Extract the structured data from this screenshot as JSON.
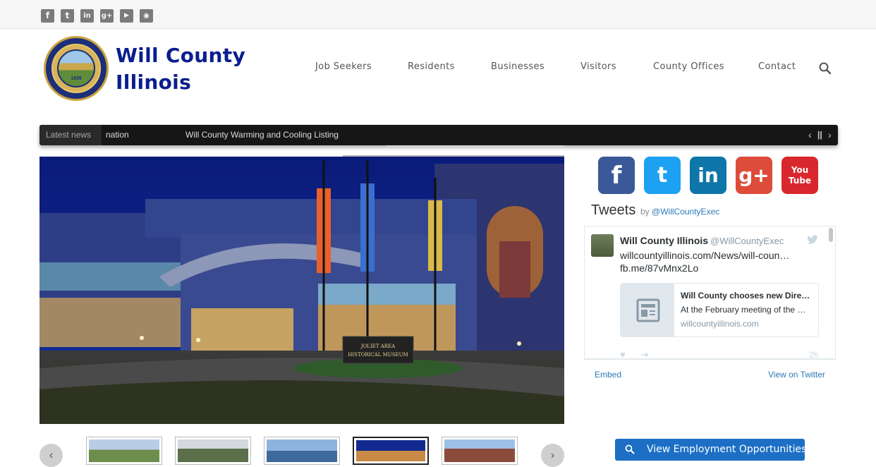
{
  "top_social": {
    "icons": [
      "facebook-icon",
      "twitter-icon",
      "linkedin-icon",
      "google-plus-icon",
      "youtube-icon",
      "rss-icon"
    ],
    "glyphs": [
      "f",
      "t",
      "in",
      "g+",
      "▶",
      "◉"
    ],
    "color": "#7b7b7b"
  },
  "header": {
    "site_name_line1": "Will County",
    "site_name_line2": "Illinois",
    "seal_year": "1836",
    "brand_color": "#0b1e8d"
  },
  "nav": {
    "items": [
      "Job Seekers",
      "Residents",
      "Businesses",
      "Visitors",
      "County Offices",
      "Contact"
    ]
  },
  "ticker": {
    "label": "Latest news",
    "items": [
      "nation",
      "Will County Warming and Cooling Listing"
    ],
    "controls": [
      "‹",
      "||",
      "›"
    ]
  },
  "hero": {
    "sign_line1": "JOLIET AREA",
    "sign_line2": "HISTORICAL MUSEUM"
  },
  "big_social": {
    "buttons": [
      {
        "icon": "facebook-icon",
        "glyph": "f",
        "color": "#3b5998"
      },
      {
        "icon": "twitter-icon",
        "glyph": "t",
        "color": "#1da1f2"
      },
      {
        "icon": "linkedin-icon",
        "glyph": "in",
        "color": "#0e76a8"
      },
      {
        "icon": "google-plus-icon",
        "glyph": "g+",
        "color": "#dd4b39"
      },
      {
        "icon": "youtube-icon",
        "glyph": "You Tube",
        "color": "#d9272e"
      }
    ]
  },
  "tweets": {
    "title": "Tweets",
    "by": "by",
    "handle_link": "@WillCountyExec",
    "tweet": {
      "name": "Will County Illinois",
      "handle": "@WillCountyExec",
      "text_line1": "willcountyillinois.com/News/will-coun…",
      "text_line2": "fb.me/87vMnx2Lo",
      "card_title": "Will County chooses new Dire…",
      "card_desc": "At the February meeting of the …",
      "card_url": "willcountyillinois.com",
      "time": "2h",
      "actions": [
        "♥",
        "⇥"
      ]
    },
    "embed": "Embed",
    "view_on_twitter": "View on Twitter"
  },
  "carousel": {
    "prev": "‹",
    "next": "›",
    "active_index": 3
  },
  "employment": {
    "label": "View Employment Opportunities",
    "color": "#1c6fc5"
  }
}
